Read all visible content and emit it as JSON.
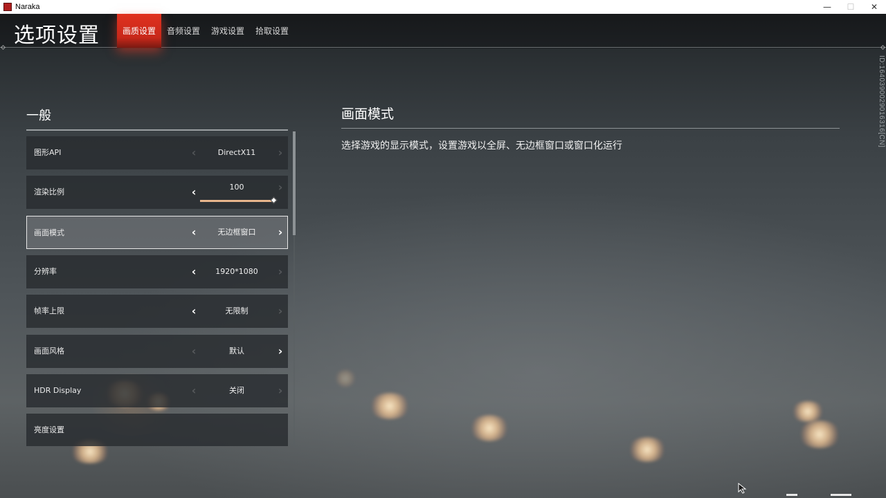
{
  "window": {
    "title": "Naraka",
    "minimize": "—",
    "maximize": "☐",
    "close": "✕"
  },
  "header": {
    "title": "选项设置",
    "tabs": [
      {
        "label": "画质设置",
        "active": true
      },
      {
        "label": "音频设置",
        "active": false
      },
      {
        "label": "游戏设置",
        "active": false
      },
      {
        "label": "拾取设置",
        "active": false
      }
    ]
  },
  "build_id": "ID:1640390029016316[CN]",
  "general": {
    "title": "一般",
    "items": [
      {
        "label": "图形API",
        "value": "DirectX11",
        "left_enabled": false,
        "right_enabled": false
      },
      {
        "label": "渲染比例",
        "value": "100",
        "left_enabled": true,
        "right_enabled": false,
        "slider_level": 1.0
      },
      {
        "label": "画面模式",
        "value": "无边框窗口",
        "left_enabled": true,
        "right_enabled": true,
        "selected": true
      },
      {
        "label": "分辨率",
        "value": "1920*1080",
        "left_enabled": true,
        "right_enabled": false
      },
      {
        "label": "帧率上限",
        "value": "无限制",
        "left_enabled": true,
        "right_enabled": false
      },
      {
        "label": "画面风格",
        "value": "默认",
        "left_enabled": false,
        "right_enabled": true
      },
      {
        "label": "HDR Display",
        "value": "关闭",
        "left_enabled": false,
        "right_enabled": false
      },
      {
        "label": "亮度设置",
        "value": ""
      }
    ]
  },
  "description": {
    "title": "画面模式",
    "text": "选择游戏的显示模式，设置游戏以全屏、无边框窗口或窗口化运行"
  },
  "colors": {
    "accent": "#e0321f",
    "slider": "#e8b58c"
  },
  "icons": {
    "left_arrow": "‹",
    "right_arrow": "›"
  }
}
